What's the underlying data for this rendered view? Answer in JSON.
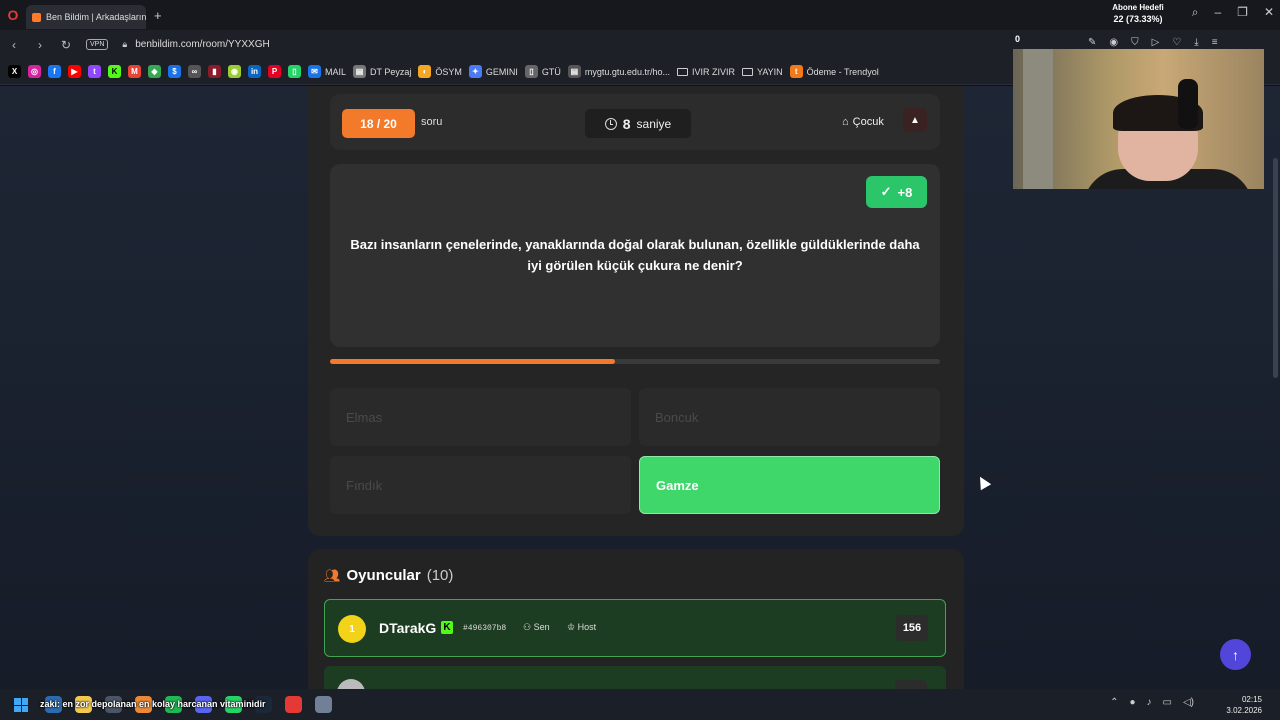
{
  "browser": {
    "tab_title": "Ben Bildim | Arkadaşlarınla",
    "url": "benbildim.com/room/YYXXGH",
    "vpn_label": "VPN",
    "bookmarks": [
      {
        "label": "MAIL"
      },
      {
        "label": "DT Peyzaj"
      },
      {
        "label": "ÖSYM"
      },
      {
        "label": "GEMINI"
      },
      {
        "label": "GTÜ"
      },
      {
        "label": "mygtu.gtu.edu.tr/ho..."
      },
      {
        "label": "IVIR ZIVIR"
      },
      {
        "label": "YAYIN"
      },
      {
        "label": "Ödeme - Trendyol"
      }
    ]
  },
  "stream_overlay": {
    "goal_title": "Abone Hedefi",
    "goal_value": "22 (73.33%)",
    "goal_start": "0"
  },
  "quiz": {
    "counter": "18 / 20",
    "counter_suffix": "soru",
    "timer_value": "8",
    "timer_unit": "saniye",
    "category": "Çocuk",
    "points": "+8",
    "question": "Bazı insanların çenelerinde, yanaklarında doğal olarak bulunan, özellikle güldüklerinde daha iyi görülen küçük çukura ne denir?",
    "progress_fraction": 0.467,
    "options": [
      {
        "label": "Elmas",
        "correct": false
      },
      {
        "label": "Boncuk",
        "correct": false
      },
      {
        "label": "Fındık",
        "correct": false
      },
      {
        "label": "Gamze",
        "correct": true
      }
    ],
    "accent_color": "#f27a2a",
    "correct_color": "#3fd66a"
  },
  "players": {
    "title": "Oyuncular",
    "count": "(10)",
    "list": [
      {
        "rank": "1",
        "name": "DTarakG",
        "id": "#496307b8",
        "tag_self": "Sen",
        "tag_host": "Host",
        "score": "156"
      }
    ]
  },
  "taskbar": {
    "ticker": "zaki: en zor depolanan en kolay harcanan vitaminidir",
    "time": "02:15",
    "date": "3.02.2026"
  }
}
